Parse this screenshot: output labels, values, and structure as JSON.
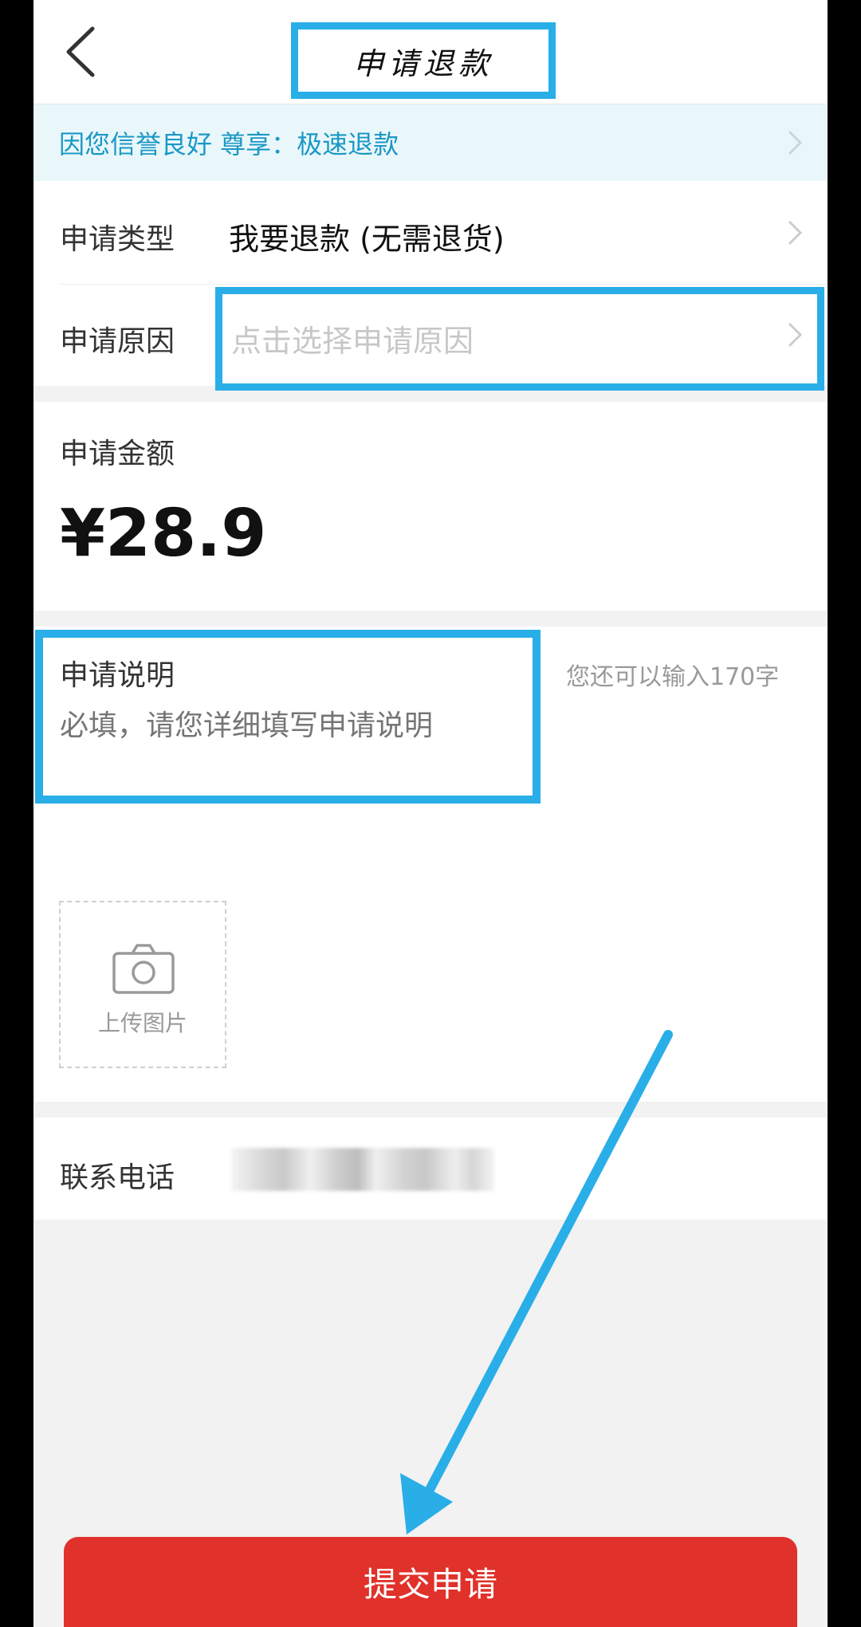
{
  "header": {
    "title": "申请退款"
  },
  "notice": {
    "text": "因您信誉良好 尊享：极速退款"
  },
  "form": {
    "type_label": "申请类型",
    "type_value": "我要退款 (无需退货)",
    "reason_label": "申请原因",
    "reason_placeholder": "点击选择申请原因",
    "amount_label": "申请金额",
    "amount_value": "¥28.9",
    "desc_label": "申请说明",
    "desc_placeholder": "必填，请您详细填写申请说明",
    "desc_counter": "您还可以输入170字",
    "upload_label": "上传图片",
    "phone_label": "联系电话"
  },
  "footer": {
    "submit_label": "提交申请"
  },
  "colors": {
    "accent": "#29aee8",
    "submit": "#e0312a",
    "notice_text": "#1a98c4"
  }
}
